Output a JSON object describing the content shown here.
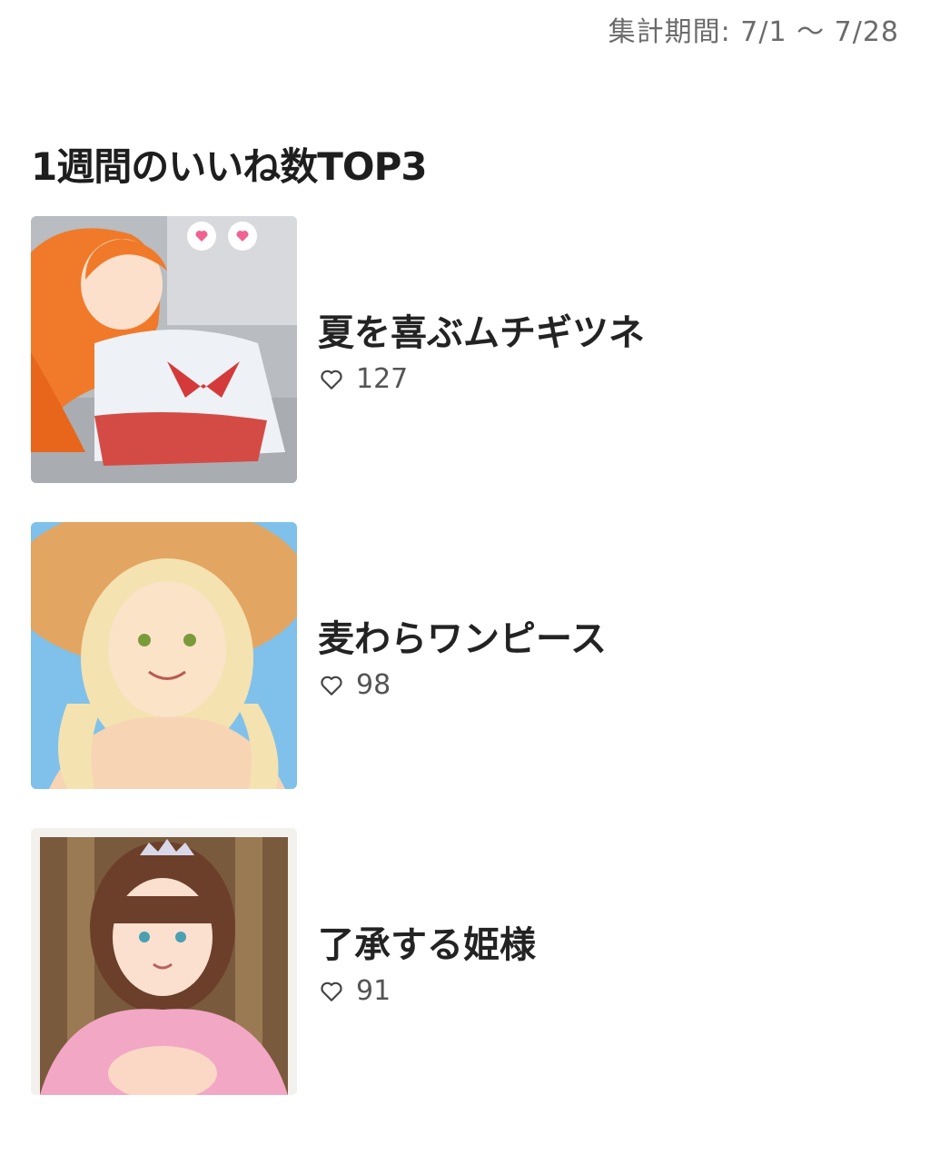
{
  "header": {
    "period_text": "集計期間: 7/1 〜 7/28"
  },
  "section": {
    "title": "1週間のいいね数TOP3"
  },
  "ranking": [
    {
      "title": "夏を喜ぶムチギツネ",
      "likes": "127"
    },
    {
      "title": "麦わらワンピース",
      "likes": "98"
    },
    {
      "title": "了承する姫様",
      "likes": "91"
    }
  ],
  "icons": {
    "like": "heart-outline-icon"
  },
  "colors": {
    "text_primary": "#232323",
    "text_secondary": "#6b6b6b",
    "background": "#ffffff"
  }
}
